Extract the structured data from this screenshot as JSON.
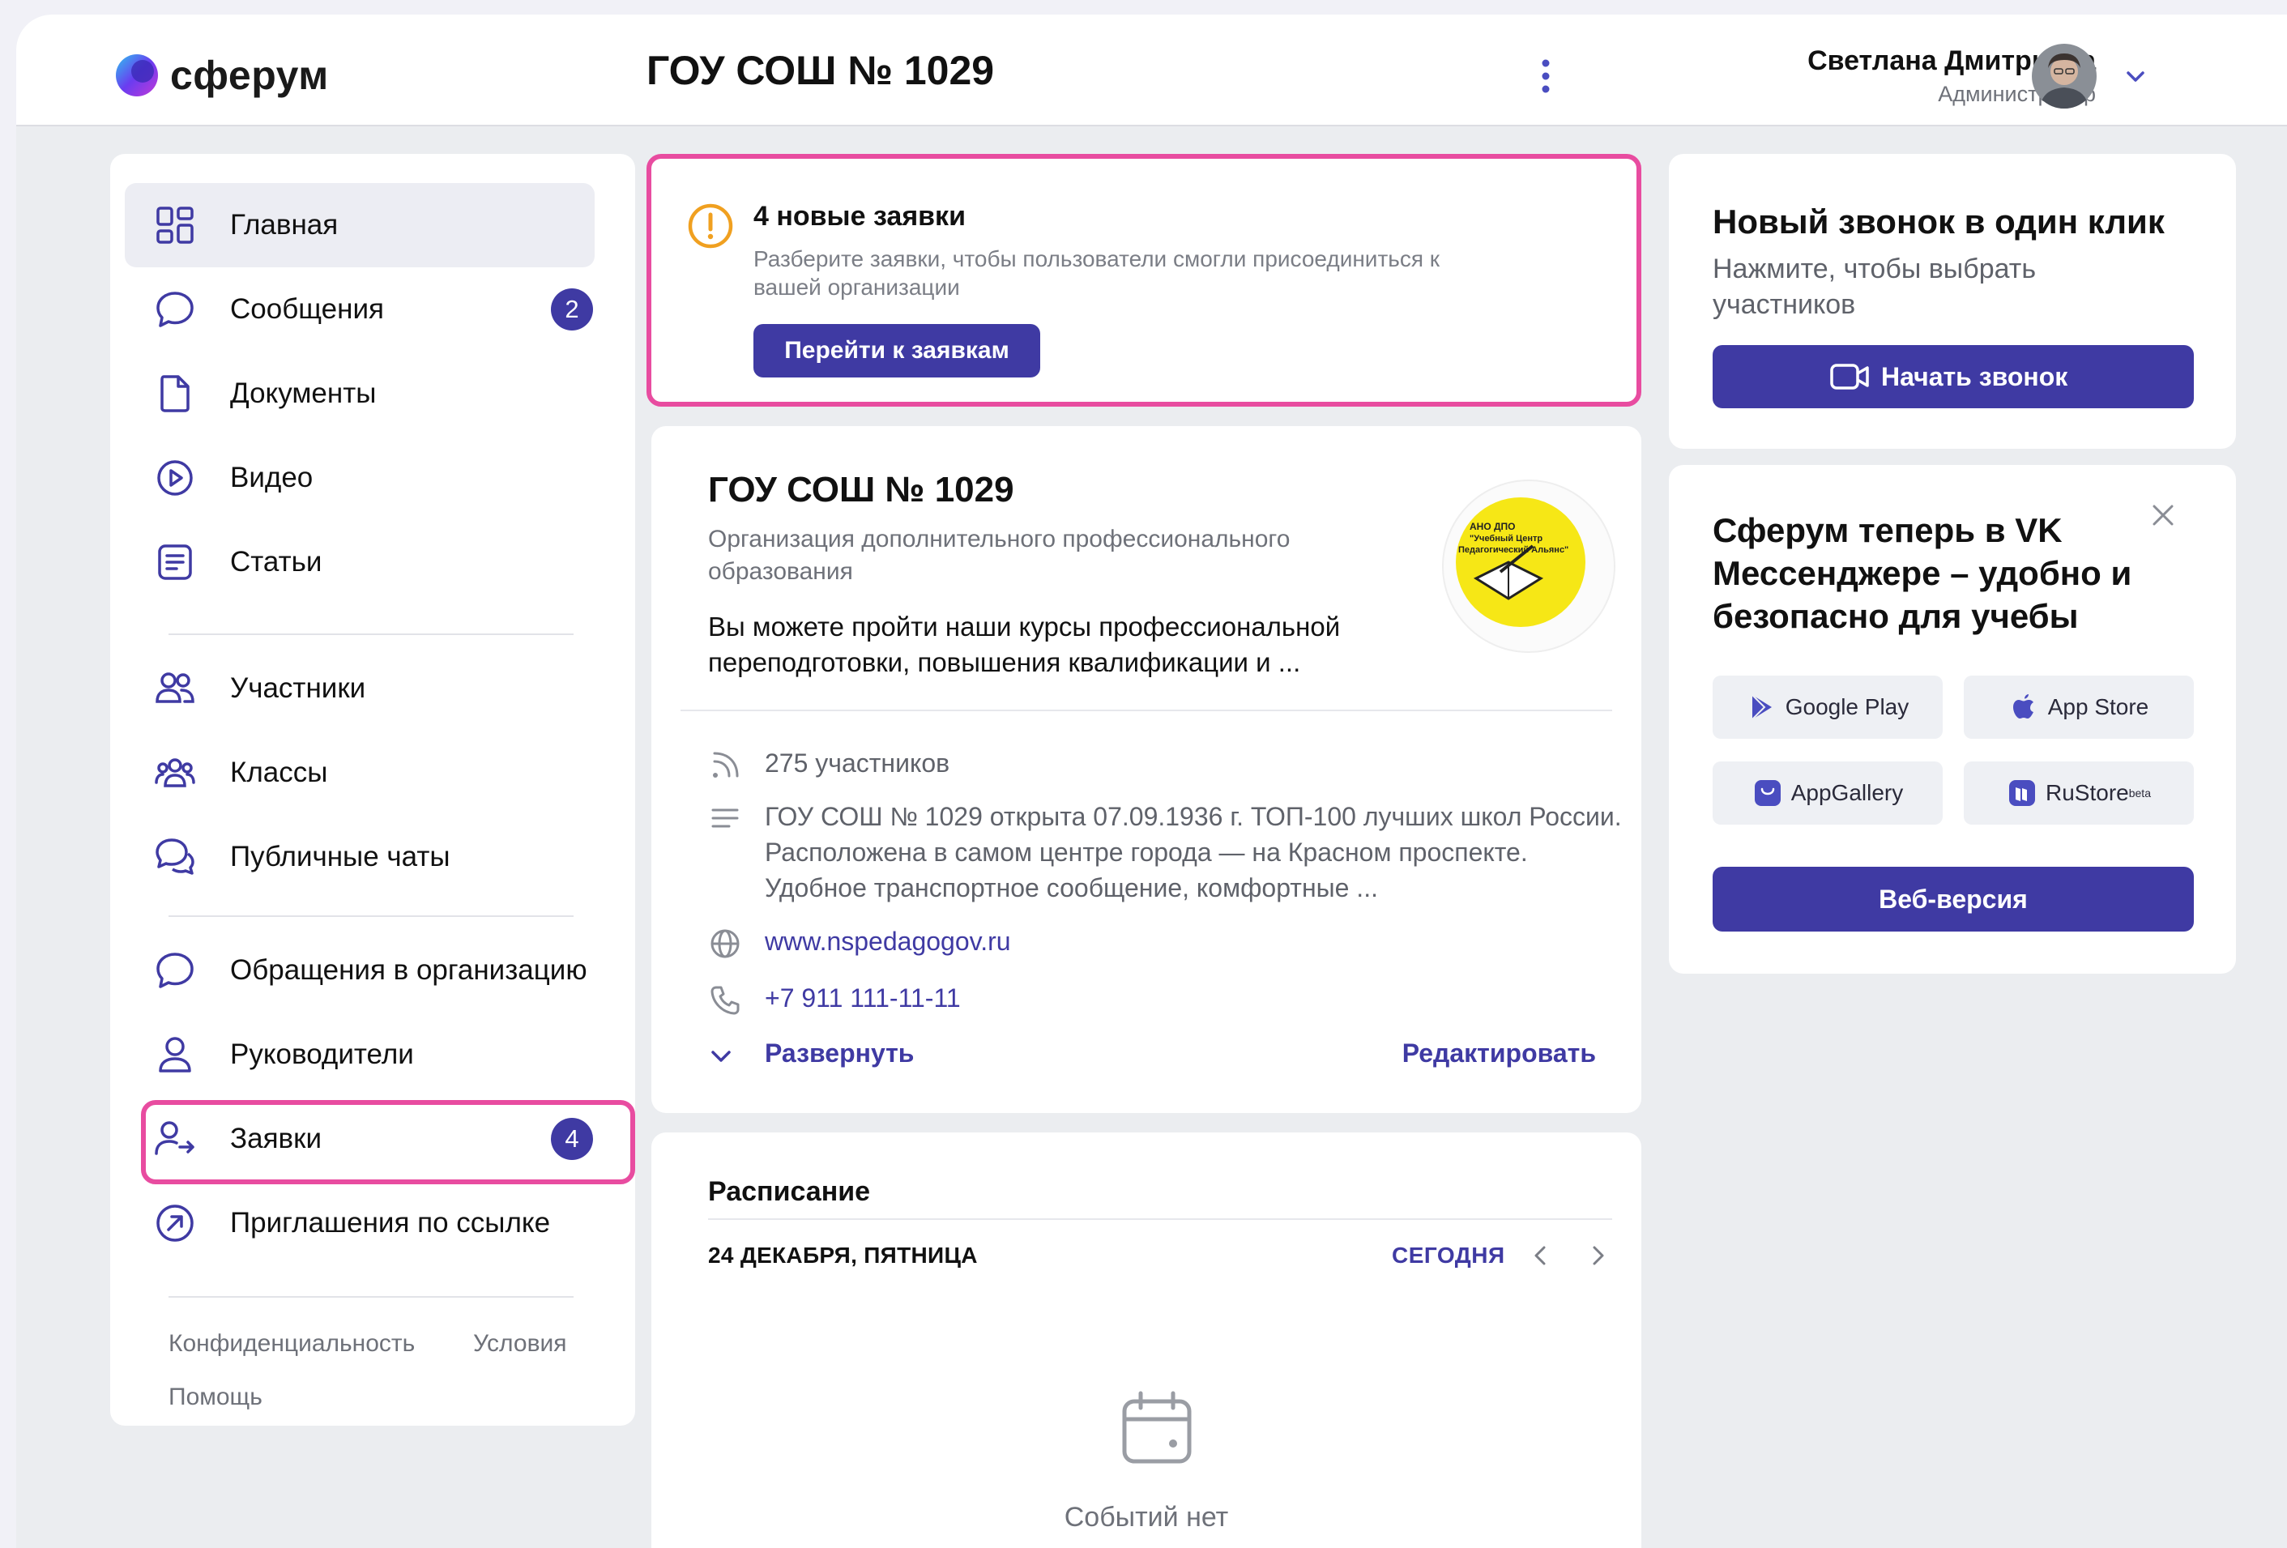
{
  "app": {
    "brand": "сферум",
    "accent_color": "#3f3aa3",
    "highlight_color": "#e84ca0"
  },
  "header": {
    "org_title": "ГОУ СОШ № 1029",
    "user_name": "Светлана Дмитриева",
    "user_role": "Администратор"
  },
  "sidebar": {
    "items": [
      {
        "label": "Главная",
        "icon": "grid-icon",
        "active": true
      },
      {
        "label": "Сообщения",
        "icon": "chat-bubble-icon",
        "badge": "2"
      },
      {
        "label": "Документы",
        "icon": "document-icon"
      },
      {
        "label": "Видео",
        "icon": "play-circle-icon"
      },
      {
        "label": "Статьи",
        "icon": "article-icon"
      },
      {
        "label": "Участники",
        "icon": "users-icon"
      },
      {
        "label": "Классы",
        "icon": "group-icon"
      },
      {
        "label": "Публичные чаты",
        "icon": "chats-icon"
      },
      {
        "label": "Обращения в организацию",
        "icon": "chat-bubble-icon"
      },
      {
        "label": "Руководители",
        "icon": "person-icon"
      },
      {
        "label": "Заявки",
        "icon": "user-arrow-icon",
        "badge": "4"
      },
      {
        "label": "Приглашения по ссылке",
        "icon": "link-arrow-icon"
      }
    ],
    "footer": {
      "privacy": "Конфиденциальность",
      "terms": "Условия",
      "help": "Помощь"
    }
  },
  "requests": {
    "title": "4 новые заявки",
    "subtitle": "Разберите заявки, чтобы пользователи смогли присоединиться к вашей организации",
    "button": "Перейти к заявкам"
  },
  "org": {
    "name": "ГОУ СОШ № 1029",
    "type": "Организация дополнительного профессионального образования",
    "description": "Вы можете пройти наши курсы профессиональной переподготовки, повышения квалификации и ...",
    "logo_lines": [
      "АНО ДПО",
      "\"Учебный Центр",
      "Педагогический Альянс\""
    ],
    "members": "275 участников",
    "about": "ГОУ СОШ № 1029 открыта 07.09.1936 г. ТОП-100 лучших школ России. Расположена в самом центре города — на Красном проспекте. Удобное транспортное сообщение, комфортные ...",
    "website": "www.nspedagogov.ru",
    "phone": "+7 911 111-11-11",
    "expand": "Развернуть",
    "edit": "Редактировать"
  },
  "schedule": {
    "title": "Расписание",
    "date": "24 ДЕКАБРЯ, ПЯТНИЦА",
    "today": "СЕГОДНЯ",
    "empty": "Событий нет"
  },
  "call": {
    "title": "Новый звонок в один клик",
    "subtitle": "Нажмите, чтобы выбрать участников",
    "button": "Начать звонок"
  },
  "promo": {
    "title": "Сферум теперь в VK Мессенджере – удобно и безопасно для учебы",
    "stores": [
      "Google Play",
      "App Store",
      "AppGallery",
      "RuStore"
    ],
    "rustore_tag": "beta",
    "web": "Веб-версия"
  }
}
